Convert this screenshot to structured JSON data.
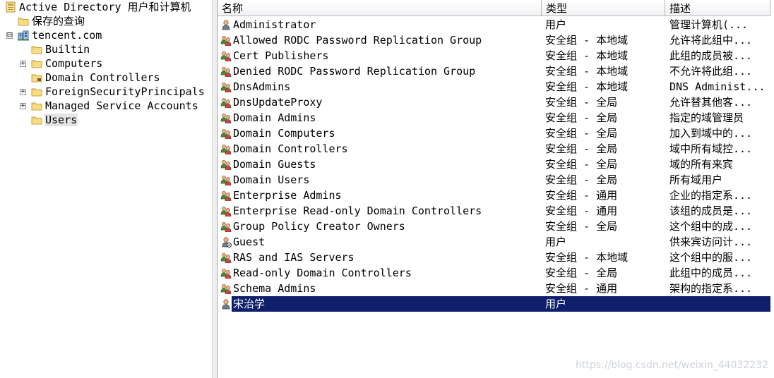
{
  "tree": {
    "root": {
      "label": "Active Directory 用户和计算机",
      "icon": "ad-console-icon"
    },
    "saved_queries": {
      "label": "保存的查询",
      "icon": "folder-icon"
    },
    "domain": {
      "label": "tencent.com",
      "icon": "domain-icon",
      "expander": "⊟"
    },
    "children": [
      {
        "label": "Builtin",
        "icon": "folder-icon",
        "expander": ""
      },
      {
        "label": "Computers",
        "icon": "folder-icon",
        "expander": "+"
      },
      {
        "label": "Domain Controllers",
        "icon": "ou-folder-icon",
        "expander": ""
      },
      {
        "label": "ForeignSecurityPrincipals",
        "icon": "folder-icon",
        "expander": "+"
      },
      {
        "label": "Managed Service Accounts",
        "icon": "folder-icon",
        "expander": "+"
      },
      {
        "label": "Users",
        "icon": "folder-icon",
        "expander": "",
        "selected": true
      }
    ]
  },
  "list": {
    "columns": {
      "name": "名称",
      "type": "类型",
      "desc": "描述"
    },
    "rows": [
      {
        "name": "Administrator",
        "type": "用户",
        "desc": "管理计算机(...",
        "icon": "user-icon"
      },
      {
        "name": "Allowed RODC Password Replication Group",
        "type": "安全组 - 本地域",
        "desc": "允许将此组中...",
        "icon": "group-icon"
      },
      {
        "name": "Cert Publishers",
        "type": "安全组 - 本地域",
        "desc": "此组的成员被...",
        "icon": "group-icon"
      },
      {
        "name": "Denied RODC Password Replication Group",
        "type": "安全组 - 本地域",
        "desc": "不允许将此组...",
        "icon": "group-icon"
      },
      {
        "name": "DnsAdmins",
        "type": "安全组 - 本地域",
        "desc": "DNS Administ...",
        "icon": "group-icon"
      },
      {
        "name": "DnsUpdateProxy",
        "type": "安全组 - 全局",
        "desc": "允许替其他客...",
        "icon": "group-icon"
      },
      {
        "name": "Domain Admins",
        "type": "安全组 - 全局",
        "desc": "指定的域管理员",
        "icon": "group-icon"
      },
      {
        "name": "Domain Computers",
        "type": "安全组 - 全局",
        "desc": "加入到域中的...",
        "icon": "group-icon"
      },
      {
        "name": "Domain Controllers",
        "type": "安全组 - 全局",
        "desc": "域中所有域控...",
        "icon": "group-icon"
      },
      {
        "name": "Domain Guests",
        "type": "安全组 - 全局",
        "desc": "域的所有来宾",
        "icon": "group-icon"
      },
      {
        "name": "Domain Users",
        "type": "安全组 - 全局",
        "desc": "所有域用户",
        "icon": "group-icon"
      },
      {
        "name": "Enterprise Admins",
        "type": "安全组 - 通用",
        "desc": "企业的指定系...",
        "icon": "group-icon"
      },
      {
        "name": "Enterprise Read-only Domain Controllers",
        "type": "安全组 - 通用",
        "desc": "该组的成员是...",
        "icon": "group-icon"
      },
      {
        "name": "Group Policy Creator Owners",
        "type": "安全组 - 全局",
        "desc": "这个组中的成...",
        "icon": "group-icon"
      },
      {
        "name": "Guest",
        "type": "用户",
        "desc": "供来宾访问计...",
        "icon": "user-disabled-icon"
      },
      {
        "name": "RAS and IAS Servers",
        "type": "安全组 - 本地域",
        "desc": "这个组中的服...",
        "icon": "group-icon"
      },
      {
        "name": "Read-only Domain Controllers",
        "type": "安全组 - 全局",
        "desc": "此组中的成员...",
        "icon": "group-icon"
      },
      {
        "name": "Schema Admins",
        "type": "安全组 - 通用",
        "desc": "架构的指定系...",
        "icon": "group-icon"
      },
      {
        "name": "宋治学",
        "type": "用户",
        "desc": "",
        "icon": "user-icon",
        "selected": true
      }
    ]
  },
  "watermark": "https://blog.csdn.net/weixin_44032232",
  "colors": {
    "selection": "#0f1f6b",
    "tree_selection": "#e3e3e3",
    "folder": "#f2c94c"
  }
}
